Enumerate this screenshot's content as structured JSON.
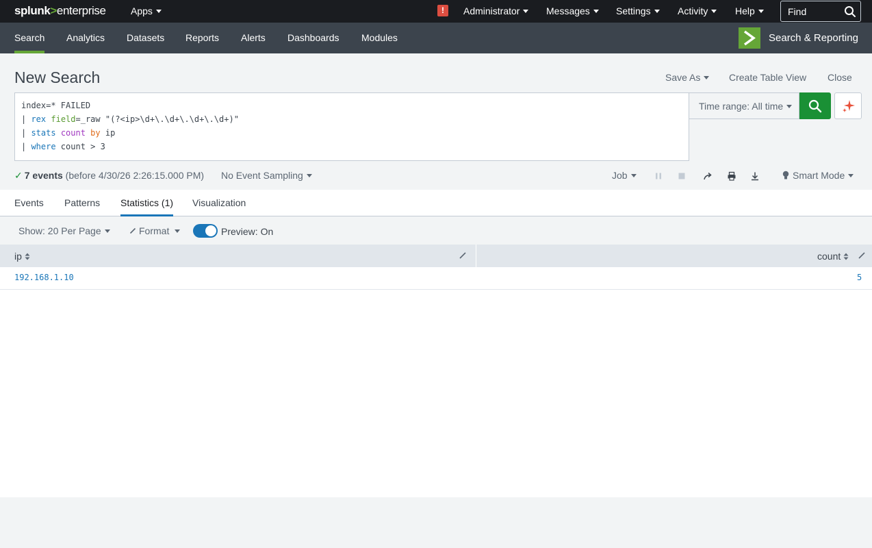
{
  "topbar": {
    "logo_part1": "splunk",
    "logo_part2": ">",
    "logo_part3": "enterprise",
    "apps": "Apps",
    "alert_glyph": "!",
    "administrator": "Administrator",
    "messages": "Messages",
    "settings": "Settings",
    "activity": "Activity",
    "help": "Help",
    "find": "Find"
  },
  "navbar": {
    "tabs": [
      "Search",
      "Analytics",
      "Datasets",
      "Reports",
      "Alerts",
      "Dashboards",
      "Modules"
    ],
    "active_tab": "Search",
    "app_name": "Search & Reporting"
  },
  "page": {
    "title": "New Search",
    "save_as": "Save As",
    "create_table_view": "Create Table View",
    "close": "Close"
  },
  "search": {
    "line1": "index=* FAILED",
    "line2": {
      "pipe": "| ",
      "cmd": "rex",
      "space": " ",
      "arg": "field",
      "rest": "=_raw \"(?<ip>\\d+\\.\\d+\\.\\d+\\.\\d+)\""
    },
    "line3": {
      "pipe": "| ",
      "cmd": "stats",
      "space1": " ",
      "func": "count",
      "space2": " ",
      "by": "by",
      "rest": " ip"
    },
    "line4": {
      "pipe": "| ",
      "cmd": "where",
      "rest": " count > 3"
    },
    "time_range": "Time range: All time"
  },
  "status": {
    "check": "✓",
    "count": "7 events",
    "detail": " (before 4/30/26 2:26:15.000 PM)",
    "sampling": "No Event Sampling",
    "job": "Job",
    "mode": "Smart Mode"
  },
  "results_tabs": [
    "Events",
    "Patterns",
    "Statistics (1)",
    "Visualization"
  ],
  "controls": {
    "per_page": "Show: 20 Per Page",
    "format": "Format",
    "preview": "Preview: On"
  },
  "table": {
    "columns": [
      "ip",
      "count"
    ],
    "rows": [
      {
        "ip": "192.168.1.10",
        "count": "5"
      }
    ]
  },
  "colors": {
    "topbar": "#1a1c20",
    "navbar": "#3c444d",
    "accent_green": "#65a637",
    "search_button": "#1a9035",
    "link_blue": "#1a76b8"
  }
}
